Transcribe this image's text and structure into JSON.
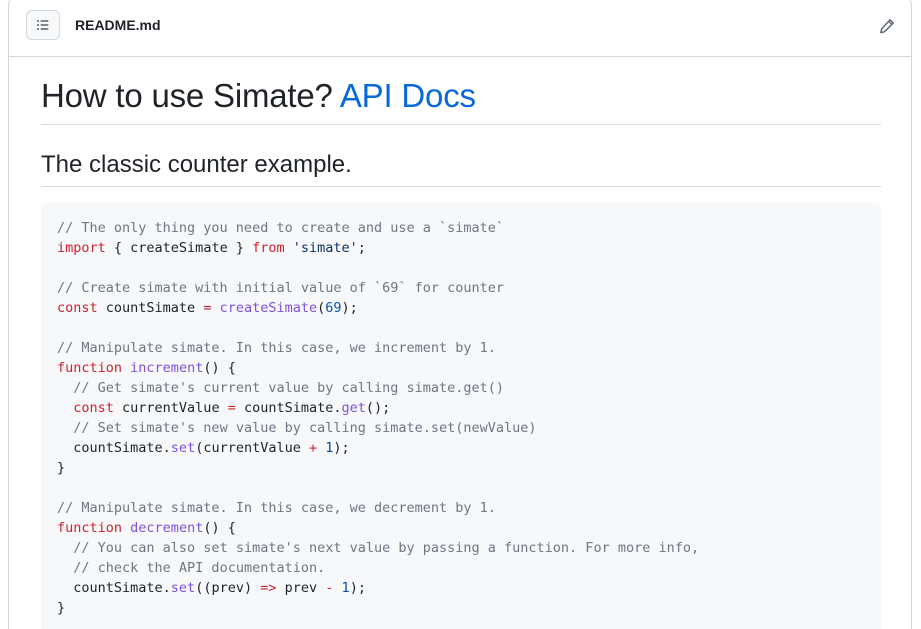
{
  "file": {
    "name": "README.md",
    "outline_icon": "list-unordered-icon",
    "edit_icon": "pencil-icon"
  },
  "heading": {
    "text": "How to use Simate? ",
    "link": "API Docs"
  },
  "subheading": "The classic counter example.",
  "code": {
    "lines": [
      [
        {
          "t": "c",
          "v": "// The only thing you need to create and use a `simate`"
        }
      ],
      [
        {
          "t": "k",
          "v": "import"
        },
        {
          "t": "p",
          "v": " { createSimate } "
        },
        {
          "t": "k",
          "v": "from"
        },
        {
          "t": "p",
          "v": " "
        },
        {
          "t": "s",
          "v": "'simate'"
        },
        {
          "t": "p",
          "v": ";"
        }
      ],
      [],
      [
        {
          "t": "c",
          "v": "// Create simate with initial value of `69` for counter"
        }
      ],
      [
        {
          "t": "k",
          "v": "const"
        },
        {
          "t": "p",
          "v": " countSimate "
        },
        {
          "t": "o",
          "v": "="
        },
        {
          "t": "p",
          "v": " "
        },
        {
          "t": "f",
          "v": "createSimate"
        },
        {
          "t": "p",
          "v": "("
        },
        {
          "t": "n",
          "v": "69"
        },
        {
          "t": "p",
          "v": ");"
        }
      ],
      [],
      [
        {
          "t": "c",
          "v": "// Manipulate simate. In this case, we increment by 1."
        }
      ],
      [
        {
          "t": "k",
          "v": "function"
        },
        {
          "t": "p",
          "v": " "
        },
        {
          "t": "f",
          "v": "increment"
        },
        {
          "t": "p",
          "v": "() {"
        }
      ],
      [
        {
          "t": "p",
          "v": "  "
        },
        {
          "t": "c",
          "v": "// Get simate's current value by calling simate.get()"
        }
      ],
      [
        {
          "t": "p",
          "v": "  "
        },
        {
          "t": "k",
          "v": "const"
        },
        {
          "t": "p",
          "v": " currentValue "
        },
        {
          "t": "o",
          "v": "="
        },
        {
          "t": "p",
          "v": " countSimate."
        },
        {
          "t": "f",
          "v": "get"
        },
        {
          "t": "p",
          "v": "();"
        }
      ],
      [
        {
          "t": "p",
          "v": "  "
        },
        {
          "t": "c",
          "v": "// Set simate's new value by calling simate.set(newValue)"
        }
      ],
      [
        {
          "t": "p",
          "v": "  countSimate."
        },
        {
          "t": "f",
          "v": "set"
        },
        {
          "t": "p",
          "v": "(currentValue "
        },
        {
          "t": "o",
          "v": "+"
        },
        {
          "t": "p",
          "v": " "
        },
        {
          "t": "n",
          "v": "1"
        },
        {
          "t": "p",
          "v": ");"
        }
      ],
      [
        {
          "t": "p",
          "v": "}"
        }
      ],
      [],
      [
        {
          "t": "c",
          "v": "// Manipulate simate. In this case, we decrement by 1."
        }
      ],
      [
        {
          "t": "k",
          "v": "function"
        },
        {
          "t": "p",
          "v": " "
        },
        {
          "t": "f",
          "v": "decrement"
        },
        {
          "t": "p",
          "v": "() {"
        }
      ],
      [
        {
          "t": "p",
          "v": "  "
        },
        {
          "t": "c",
          "v": "// You can also set simate's next value by passing a function. For more info,"
        }
      ],
      [
        {
          "t": "p",
          "v": "  "
        },
        {
          "t": "c",
          "v": "// check the API documentation."
        }
      ],
      [
        {
          "t": "p",
          "v": "  countSimate."
        },
        {
          "t": "f",
          "v": "set"
        },
        {
          "t": "p",
          "v": "((prev) "
        },
        {
          "t": "o",
          "v": "=>"
        },
        {
          "t": "p",
          "v": " prev "
        },
        {
          "t": "o",
          "v": "-"
        },
        {
          "t": "p",
          "v": " "
        },
        {
          "t": "n",
          "v": "1"
        },
        {
          "t": "p",
          "v": ");"
        }
      ],
      [
        {
          "t": "p",
          "v": "}"
        }
      ]
    ]
  },
  "colors": {
    "link": "#0969da",
    "comment": "#6e7781",
    "keyword": "#cf222e",
    "function": "#8250df",
    "number": "#0550ae",
    "string": "#0a3069"
  }
}
